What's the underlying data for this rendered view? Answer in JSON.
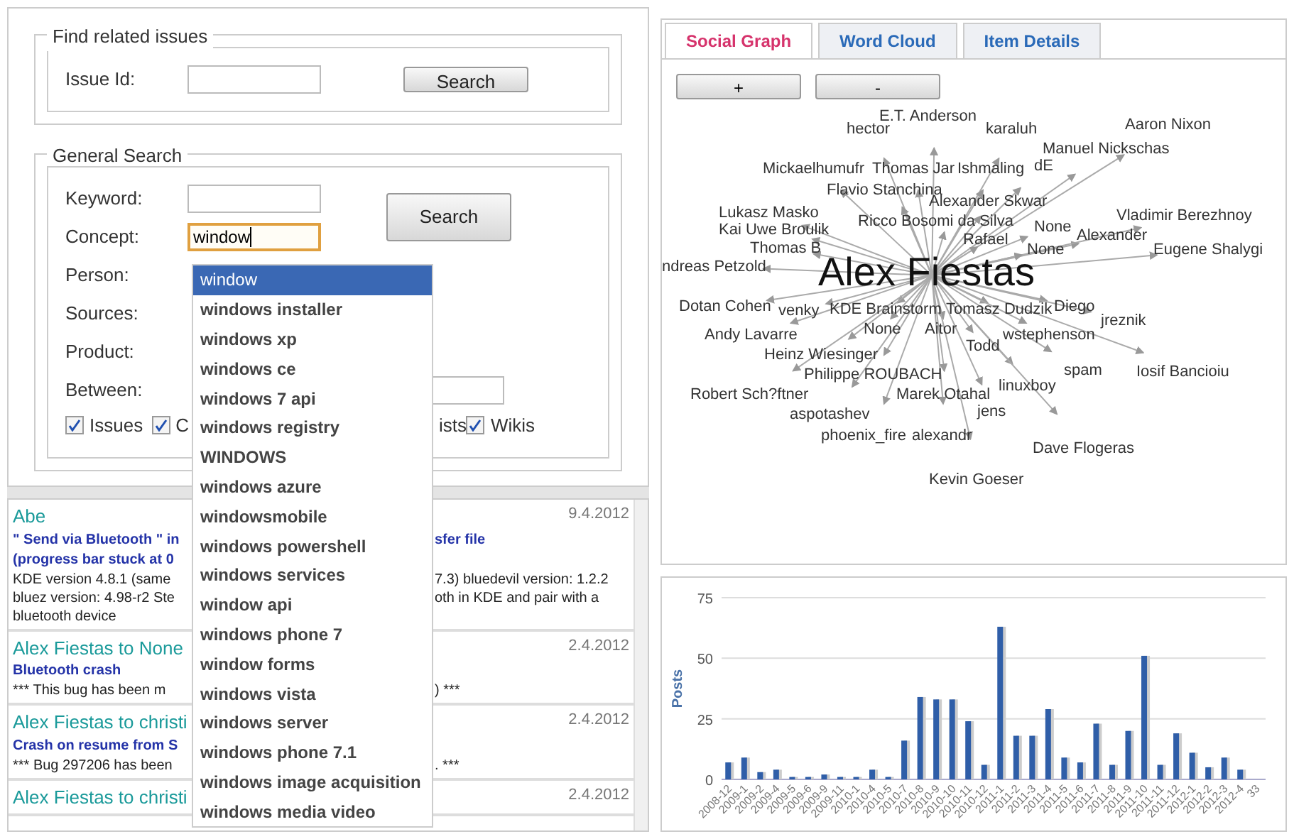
{
  "related": {
    "legend": "Find related issues",
    "label": "Issue Id:",
    "button": "Search"
  },
  "general": {
    "legend": "General Search",
    "button": "Search",
    "fields": [
      {
        "label": "Keyword:",
        "focused": false
      },
      {
        "label": "Concept:",
        "value": "window",
        "focused": true
      },
      {
        "label": "Person:"
      },
      {
        "label": "Sources:"
      },
      {
        "label": "Product:"
      },
      {
        "label": "Between:"
      }
    ],
    "checkboxes": [
      {
        "label": "Issues",
        "checked": true
      },
      {
        "label": "C",
        "checked": true
      },
      {
        "label": "ists"
      },
      {
        "label": "Wikis",
        "checked": true
      }
    ]
  },
  "suggestions": [
    {
      "label": "window",
      "selected": true
    },
    {
      "label": "windows installer",
      "selected": false
    },
    {
      "label": "windows xp",
      "selected": false
    },
    {
      "label": "windows ce",
      "selected": false
    },
    {
      "label": "windows 7 api",
      "selected": false
    },
    {
      "label": "windows registry",
      "selected": false
    },
    {
      "label": "WINDOWS",
      "selected": false
    },
    {
      "label": "windows azure",
      "selected": false
    },
    {
      "label": "windowsmobile",
      "selected": false
    },
    {
      "label": "windows powershell",
      "selected": false
    },
    {
      "label": "windows services",
      "selected": false
    },
    {
      "label": "window api",
      "selected": false
    },
    {
      "label": "windows phone 7",
      "selected": false
    },
    {
      "label": "window forms",
      "selected": false
    },
    {
      "label": "windows vista",
      "selected": false
    },
    {
      "label": "windows server",
      "selected": false
    },
    {
      "label": "windows phone 7.1",
      "selected": false
    },
    {
      "label": "windows image acquisition",
      "selected": false
    },
    {
      "label": "windows media video",
      "selected": false
    }
  ],
  "results": [
    {
      "name": "Abe",
      "date": "9.4.2012",
      "title": [
        [
          "\" Send via Bluetooth \" in",
          "sfer file"
        ],
        [
          "(progress bar stuck at 0"
        ]
      ],
      "body": [
        [
          "KDE version 4.8.1 (same",
          "7.3) bluedevil version: 1.2.2"
        ],
        [
          "bluez version: 4.98-r2 Ste",
          "oth in KDE and pair with a"
        ],
        [
          "bluetooth device"
        ]
      ]
    },
    {
      "name": "Alex Fiestas to None",
      "date": "2.4.2012",
      "title": [
        [
          "Bluetooth crash"
        ]
      ],
      "body": [
        [
          "*** This bug has been m",
          ") ***"
        ]
      ]
    },
    {
      "name": "Alex Fiestas to christi",
      "date": "2.4.2012",
      "title": [
        [
          "Crash on resume from S"
        ]
      ],
      "body": [
        [
          "*** Bug 297206 has been",
          ". ***"
        ]
      ]
    },
    {
      "name": "Alex Fiestas to christi",
      "date": "2.4.2012"
    }
  ],
  "tabs": [
    {
      "label": "Social Graph",
      "selected": true
    },
    {
      "label": "Word Cloud",
      "selected": false
    },
    {
      "label": "Item Details",
      "selected": false
    }
  ],
  "zoom_buttons": [
    "+",
    "-"
  ],
  "graph": {
    "center": "Alex Fiestas",
    "nodes": [
      "hector",
      "E.T. Anderson",
      "karaluh",
      "Aaron Nixon",
      "Manuel Nickschas",
      "Mickaelhumufr",
      "Thomas Jar",
      "Ishmaling",
      "dE",
      "Flavio Stanchina",
      "Lukasz Masko",
      "Alexander Skwar",
      "Kai Uwe Broulik",
      "Ricco Bosomi da Silva",
      "None",
      "Alexander",
      "Vladimir Berezhnoy",
      "Thomas B",
      "Eugene Shalygi",
      "ndreas Petzold",
      "Rafael",
      "None",
      "Dotan Cohen",
      "venky",
      "KDE Brainstorm",
      "Tomasz Dudzik",
      "Diego",
      "jreznik",
      "None",
      "Aitor",
      "Andy Lavarre",
      "Heinz Wiesinger",
      "Todd",
      "wstephenson",
      "Philippe ROUBACH",
      "Marek Otahal",
      "linuxboy",
      "spam",
      "Iosif Bancioiu",
      "Robert Sch?ftner",
      "aspotashev",
      "jens",
      "phoenix_fire",
      "alexandr",
      "Dave Flogeras",
      "Kevin Goeser"
    ]
  },
  "chart_data": {
    "type": "bar",
    "ylabel": "Posts",
    "ylim": [
      0,
      75
    ],
    "yticks": [
      0,
      25,
      50,
      75
    ],
    "categories": [
      "2008-12",
      "2009-1",
      "2009-2",
      "2009-4",
      "2009-5",
      "2009-6",
      "2009-9",
      "2009-11",
      "2010-1",
      "2010-4",
      "2010-5",
      "2010-7",
      "2010-8",
      "2010-9",
      "2010-10",
      "2010-11",
      "2010-12",
      "2011-1",
      "2011-2",
      "2011-3",
      "2011-4",
      "2011-5",
      "2011-6",
      "2011-7",
      "2011-8",
      "2011-9",
      "2011-10",
      "2011-11",
      "2011-12",
      "2012-1",
      "2012-2",
      "2012-3",
      "2012-4",
      "33"
    ],
    "values": [
      7,
      9,
      3,
      4,
      1,
      1,
      2,
      1,
      1,
      4,
      1,
      16,
      34,
      33,
      33,
      24,
      6,
      63,
      18,
      18,
      29,
      9,
      7,
      23,
      6,
      20,
      51,
      6,
      19,
      11,
      5,
      9,
      4,
      null
    ]
  }
}
